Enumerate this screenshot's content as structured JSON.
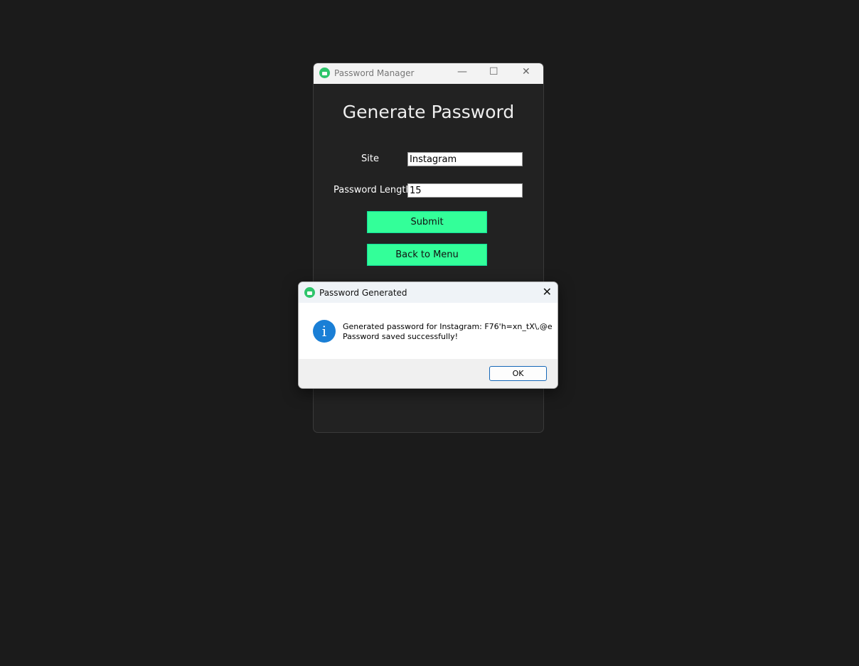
{
  "window": {
    "title": "Password Manager",
    "minimize": "—",
    "maximize": "☐",
    "close": "✕"
  },
  "form": {
    "heading": "Generate Password",
    "site_label": "Site",
    "site_value": "Instagram",
    "length_label": "Password Length",
    "length_value": "15",
    "submit": "Submit",
    "back": "Back to Menu"
  },
  "dialog": {
    "title": "Password Generated",
    "close": "✕",
    "icon": "i",
    "line1": "Generated password for Instagram: F76'h=xn_tX\\,@e",
    "line2": "Password saved successfully!",
    "ok": "OK"
  }
}
